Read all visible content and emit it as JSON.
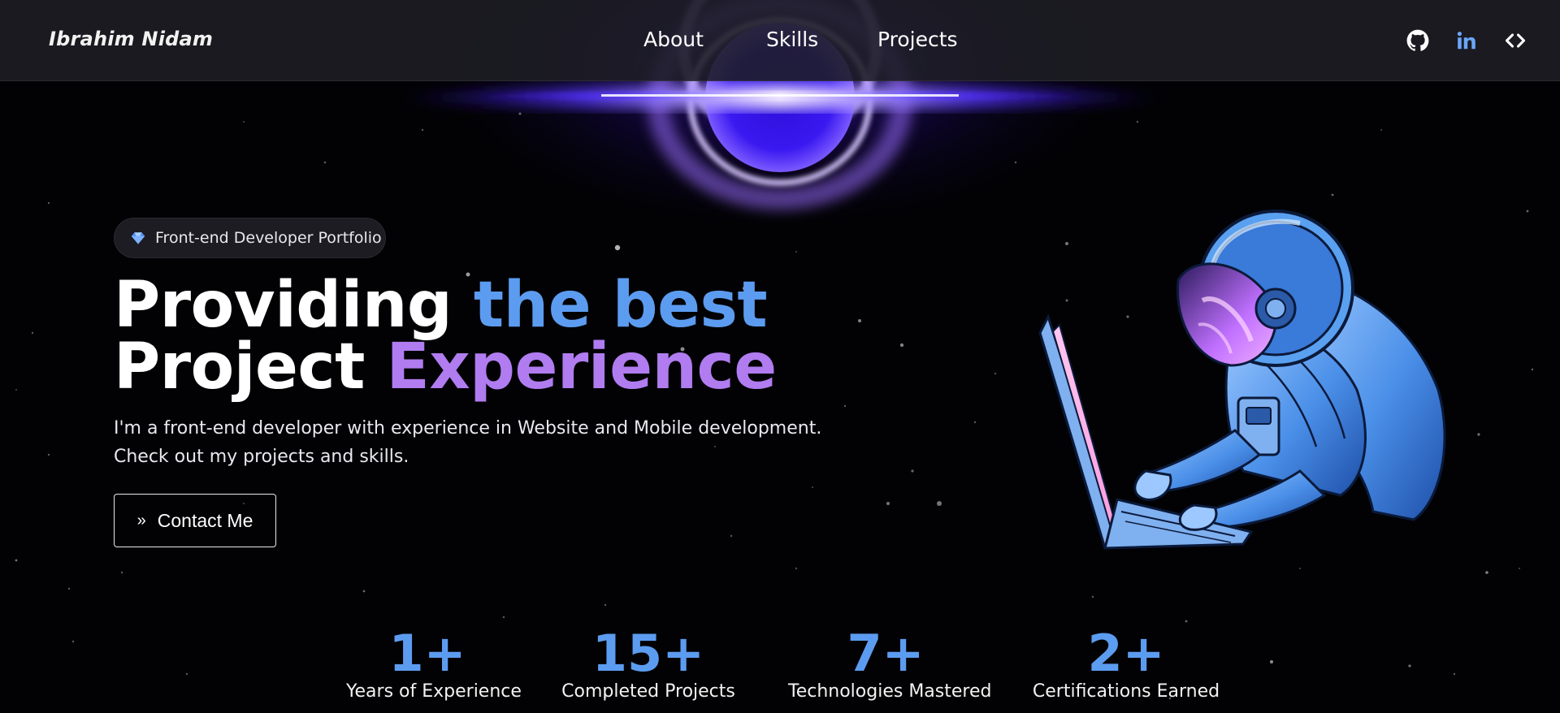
{
  "navbar": {
    "brand": "Ibrahim Nidam",
    "links": [
      "About",
      "Skills",
      "Projects"
    ],
    "social_icons": [
      "github-icon",
      "linkedin-icon",
      "code-icon"
    ]
  },
  "hero": {
    "badge": "Front-end Developer Portfolio",
    "headline": {
      "line1_white": "Providing ",
      "line1_accent": "the best",
      "line2_white": "Project ",
      "line2_accent": "Experience"
    },
    "description": {
      "line1": "I'm a front-end developer with experience in Website and Mobile development.",
      "line2": "Check out my projects and skills."
    },
    "cta_label": "Contact Me"
  },
  "stats": [
    {
      "value": "1+",
      "label": "Years of Experience"
    },
    {
      "value": "15+",
      "label": "Completed Projects"
    },
    {
      "value": "7+",
      "label": "Technologies Mastered"
    },
    {
      "value": "2+",
      "label": "Certifications Earned"
    }
  ],
  "colors": {
    "accent_blue": "#5c9cf0",
    "accent_purple": "#b07cf0",
    "background": "#020204",
    "navbar": "#1e1e24"
  }
}
